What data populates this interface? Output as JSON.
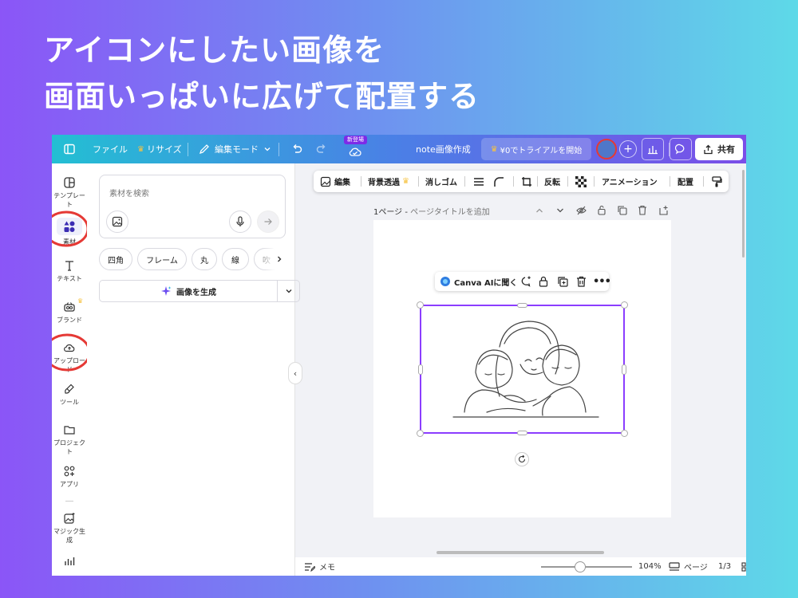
{
  "headline": {
    "line1": "アイコンにしたい画像を",
    "line2": "画面いっぱいに広げて配置する"
  },
  "topbar": {
    "file": "ファイル",
    "resize": "リサイズ",
    "edit_mode": "編集モード",
    "new_badge": "新登場",
    "doc_title": "note画像作成",
    "trial": "¥0でトライアルを開始",
    "share": "共有"
  },
  "sidebar": {
    "items": [
      {
        "label": "テンプレート"
      },
      {
        "label": "素材"
      },
      {
        "label": "テキスト"
      },
      {
        "label": "ブランド"
      },
      {
        "label": "アップロード"
      },
      {
        "label": "ツール"
      },
      {
        "label": "プロジェクト"
      },
      {
        "label": "アプリ"
      },
      {
        "label": "マジック生成"
      }
    ]
  },
  "panel": {
    "search_placeholder": "素材を検索",
    "chips": [
      "四角",
      "フレーム",
      "丸",
      "線",
      "吹"
    ],
    "generate": "画像を生成"
  },
  "context_toolbar": {
    "edit": "編集",
    "bg_remove": "背景透過",
    "eraser": "消しゴム",
    "flip": "反転",
    "animation": "アニメーション",
    "arrange": "配置"
  },
  "page_header": {
    "page": "1ページ",
    "title_placeholder": "ページタイトルを追加"
  },
  "ai_bar": {
    "label": "Canva AIに聞く"
  },
  "bottom_bar": {
    "notes": "メモ",
    "zoom_text": "104%",
    "zoom_fraction": 0.43,
    "pages_label": "ページ",
    "page_count": "1/3"
  },
  "colors": {
    "accent": "#8b3dff",
    "highlight": "#e53935",
    "crown": "#f6c343"
  }
}
